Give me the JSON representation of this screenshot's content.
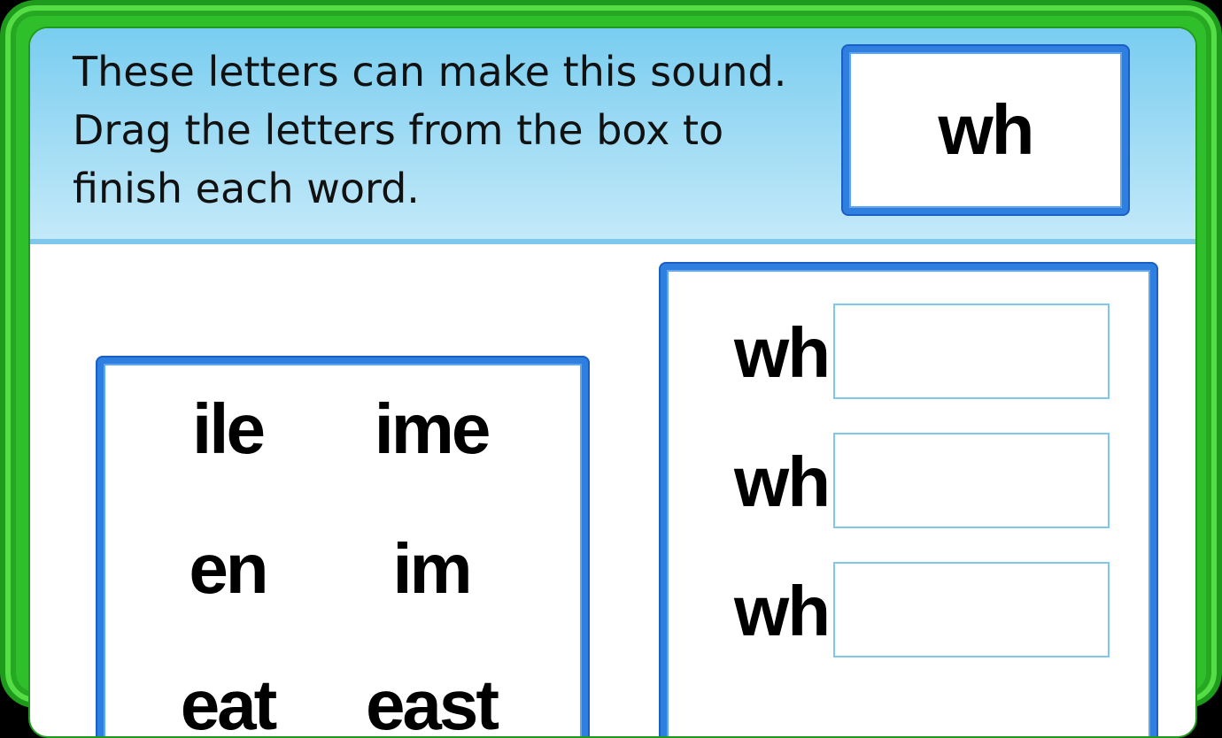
{
  "instructions": {
    "line1": "These letters can make this sound.",
    "line2": "Drag the letters from the box to",
    "line3": "finish each word."
  },
  "sound": "wh",
  "letter_tiles": [
    "ile",
    "ime",
    "en",
    "im",
    "eat",
    "east"
  ],
  "words": [
    {
      "prefix": "wh",
      "answer": ""
    },
    {
      "prefix": "wh",
      "answer": ""
    },
    {
      "prefix": "wh",
      "answer": ""
    }
  ],
  "colors": {
    "frame_green": "#2fbf2a",
    "header_blue": "#a6def5",
    "box_border_blue": "#2f7fe0",
    "slot_border": "#7fc8ec"
  }
}
